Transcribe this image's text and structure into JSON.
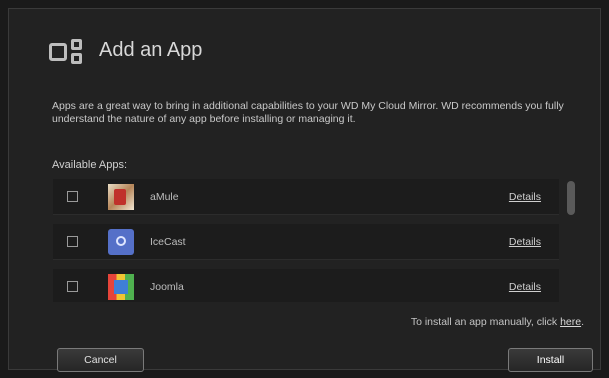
{
  "dialog": {
    "title": "Add an App",
    "description": "Apps are a great way to bring in additional capabilities to your WD My Cloud Mirror. WD recommends you fully understand the nature of any app before installing or managing it.",
    "available_label": "Available Apps:",
    "apps": [
      {
        "name": "aMule",
        "details_label": "Details",
        "icon": "amule-icon"
      },
      {
        "name": "IceCast",
        "details_label": "Details",
        "icon": "icecast-icon"
      },
      {
        "name": "Joomla",
        "details_label": "Details",
        "icon": "joomla-icon"
      }
    ],
    "manual_text": "To install an app manually, click",
    "manual_link": "here",
    "manual_suffix": ".",
    "cancel_label": "Cancel",
    "install_label": "Install"
  }
}
